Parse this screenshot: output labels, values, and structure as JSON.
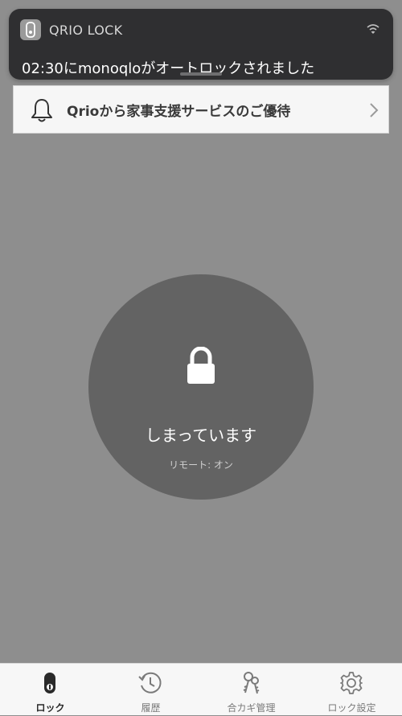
{
  "notification": {
    "app_name": "QRIO LOCK",
    "message": "02:30にmonoqloがオートロックされました",
    "app_icon": "lock-app-icon",
    "corner_icon": "wifi-icon"
  },
  "banner": {
    "text": "Qrioから家事支援サービスのご優待",
    "icon": "bell-icon",
    "chevron": "chevron-right-icon"
  },
  "lock_button": {
    "status": "しまっています",
    "remote": "リモート: オン",
    "icon": "padlock-closed-icon"
  },
  "tabbar": {
    "tabs": [
      {
        "label": "ロック",
        "icon": "lock-device-icon",
        "active": true
      },
      {
        "label": "履歴",
        "icon": "history-clock-icon",
        "active": false
      },
      {
        "label": "合カギ管理",
        "icon": "keys-icon",
        "active": false
      },
      {
        "label": "ロック設定",
        "icon": "gear-icon",
        "active": false
      }
    ]
  },
  "colors": {
    "background": "#8e8e8e",
    "circle": "#636363",
    "notification_bg": "#2f2f31",
    "tabbar_bg": "#f7f7f7"
  }
}
